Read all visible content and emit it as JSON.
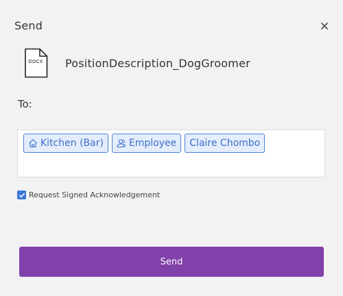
{
  "dialog": {
    "title": "Send",
    "close_icon": "close-icon"
  },
  "file": {
    "icon": "document-icon",
    "extension": "DOCX",
    "name": "PositionDescription_DogGroomer"
  },
  "to": {
    "label": "To:",
    "recipients": [
      {
        "label": "Kitchen (Bar)",
        "icon": "home-icon"
      },
      {
        "label": "Employee",
        "icon": "users-icon"
      },
      {
        "label": "Claire Chombo",
        "icon": ""
      }
    ]
  },
  "acknowledgement": {
    "label": "Request Signed Acknowledgement",
    "checked": true
  },
  "actions": {
    "send_label": "Send"
  },
  "colors": {
    "accent": "#8141ab",
    "chip_border": "#4a7fd6",
    "chip_background": "#e4edfb",
    "checkbox": "#3b79d8"
  }
}
